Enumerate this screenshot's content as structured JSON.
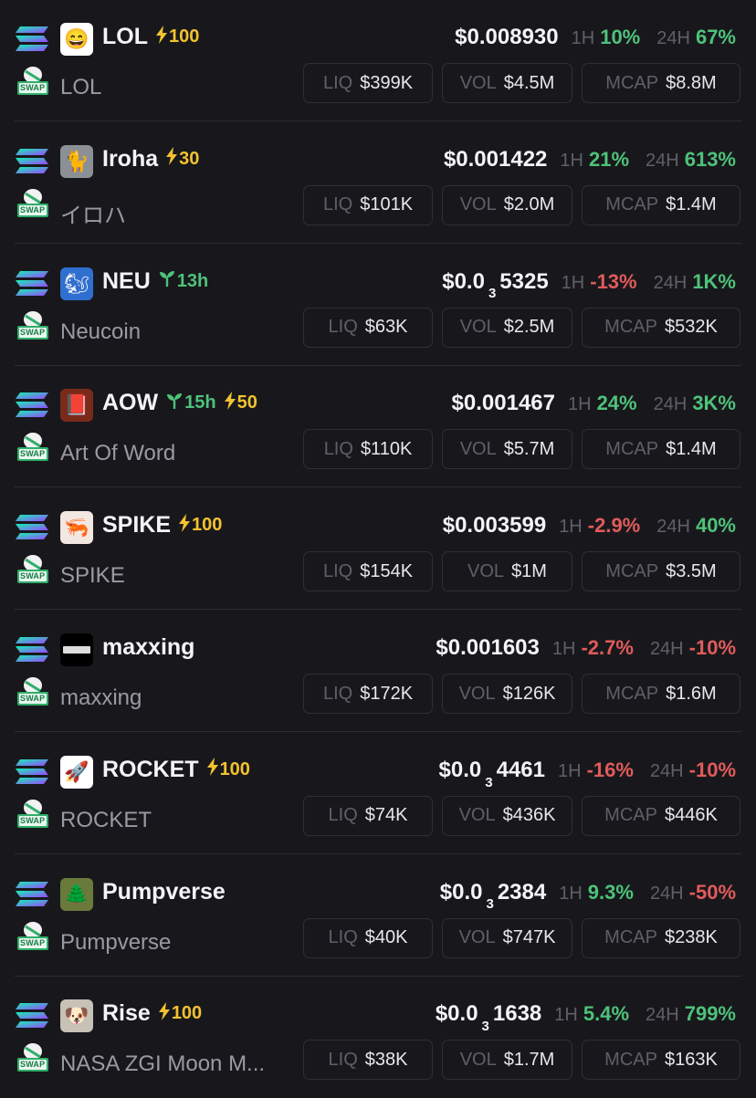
{
  "labels": {
    "h1": "1H",
    "h24": "24H",
    "liq": "LIQ",
    "vol": "VOL",
    "mcap": "MCAP",
    "swap": "SWAP"
  },
  "colors": {
    "positive": "#4ec27a",
    "negative": "#e15b5b",
    "boost": "#f2c230",
    "background": "#18181c"
  },
  "tokens": [
    {
      "symbol": "LOL",
      "boost": "100",
      "age": null,
      "name": "LOL",
      "price_prefix": "$0.008930",
      "price_sub": null,
      "price_tail": null,
      "h1": "10%",
      "h1_dir": "pos",
      "h24": "67%",
      "h24_dir": "pos",
      "liq": "$399K",
      "vol": "$4.5M",
      "mcap": "$8.8M",
      "icon": "laughing-emoji-icon"
    },
    {
      "symbol": "Iroha",
      "boost": "30",
      "age": null,
      "name": "イロハ",
      "price_prefix": "$0.001422",
      "price_sub": null,
      "price_tail": null,
      "h1": "21%",
      "h1_dir": "pos",
      "h24": "613%",
      "h24_dir": "pos",
      "liq": "$101K",
      "vol": "$2.0M",
      "mcap": "$1.4M",
      "icon": "cat-photo-icon"
    },
    {
      "symbol": "NEU",
      "boost": null,
      "age": "13h",
      "name": "Neucoin",
      "price_prefix": "$0.0",
      "price_sub": "3",
      "price_tail": "5325",
      "h1": "-13%",
      "h1_dir": "neg",
      "h24": "1K%",
      "h24_dir": "pos",
      "liq": "$63K",
      "vol": "$2.5M",
      "mcap": "$532K",
      "icon": "squirrel-icon"
    },
    {
      "symbol": "AOW",
      "boost": "50",
      "age": "15h",
      "name": "Art Of Word",
      "price_prefix": "$0.001467",
      "price_sub": null,
      "price_tail": null,
      "h1": "24%",
      "h1_dir": "pos",
      "h24": "3K%",
      "h24_dir": "pos",
      "liq": "$110K",
      "vol": "$5.7M",
      "mcap": "$1.4M",
      "icon": "book-cover-icon"
    },
    {
      "symbol": "SPIKE",
      "boost": "100",
      "age": null,
      "name": "SPIKE",
      "price_prefix": "$0.003599",
      "price_sub": null,
      "price_tail": null,
      "h1": "-2.9%",
      "h1_dir": "neg",
      "h24": "40%",
      "h24_dir": "pos",
      "liq": "$154K",
      "vol": "$1M",
      "mcap": "$3.5M",
      "icon": "shrimp-icon"
    },
    {
      "symbol": "maxxing",
      "boost": null,
      "age": null,
      "name": "maxxing",
      "price_prefix": "$0.001603",
      "price_sub": null,
      "price_tail": null,
      "h1": "-2.7%",
      "h1_dir": "neg",
      "h24": "-10%",
      "h24_dir": "neg",
      "liq": "$172K",
      "vol": "$126K",
      "mcap": "$1.6M",
      "icon": "maxxing-logo-icon"
    },
    {
      "symbol": "ROCKET",
      "boost": "100",
      "age": null,
      "name": "ROCKET",
      "price_prefix": "$0.0",
      "price_sub": "3",
      "price_tail": "4461",
      "h1": "-16%",
      "h1_dir": "neg",
      "h24": "-10%",
      "h24_dir": "neg",
      "liq": "$74K",
      "vol": "$436K",
      "mcap": "$446K",
      "icon": "rocket-icon"
    },
    {
      "symbol": "Pumpverse",
      "boost": null,
      "age": null,
      "name": "Pumpverse",
      "price_prefix": "$0.0",
      "price_sub": "3",
      "price_tail": "2384",
      "h1": "9.3%",
      "h1_dir": "pos",
      "h24": "-50%",
      "h24_dir": "neg",
      "liq": "$40K",
      "vol": "$747K",
      "mcap": "$238K",
      "icon": "landscape-art-icon"
    },
    {
      "symbol": "Rise",
      "boost": "100",
      "age": null,
      "name": "NASA ZGI Moon M...",
      "price_prefix": "$0.0",
      "price_sub": "3",
      "price_tail": "1638",
      "h1": "5.4%",
      "h1_dir": "pos",
      "h24": "799%",
      "h24_dir": "pos",
      "liq": "$38K",
      "vol": "$1.7M",
      "mcap": "$163K",
      "icon": "astronaut-dog-icon"
    }
  ]
}
